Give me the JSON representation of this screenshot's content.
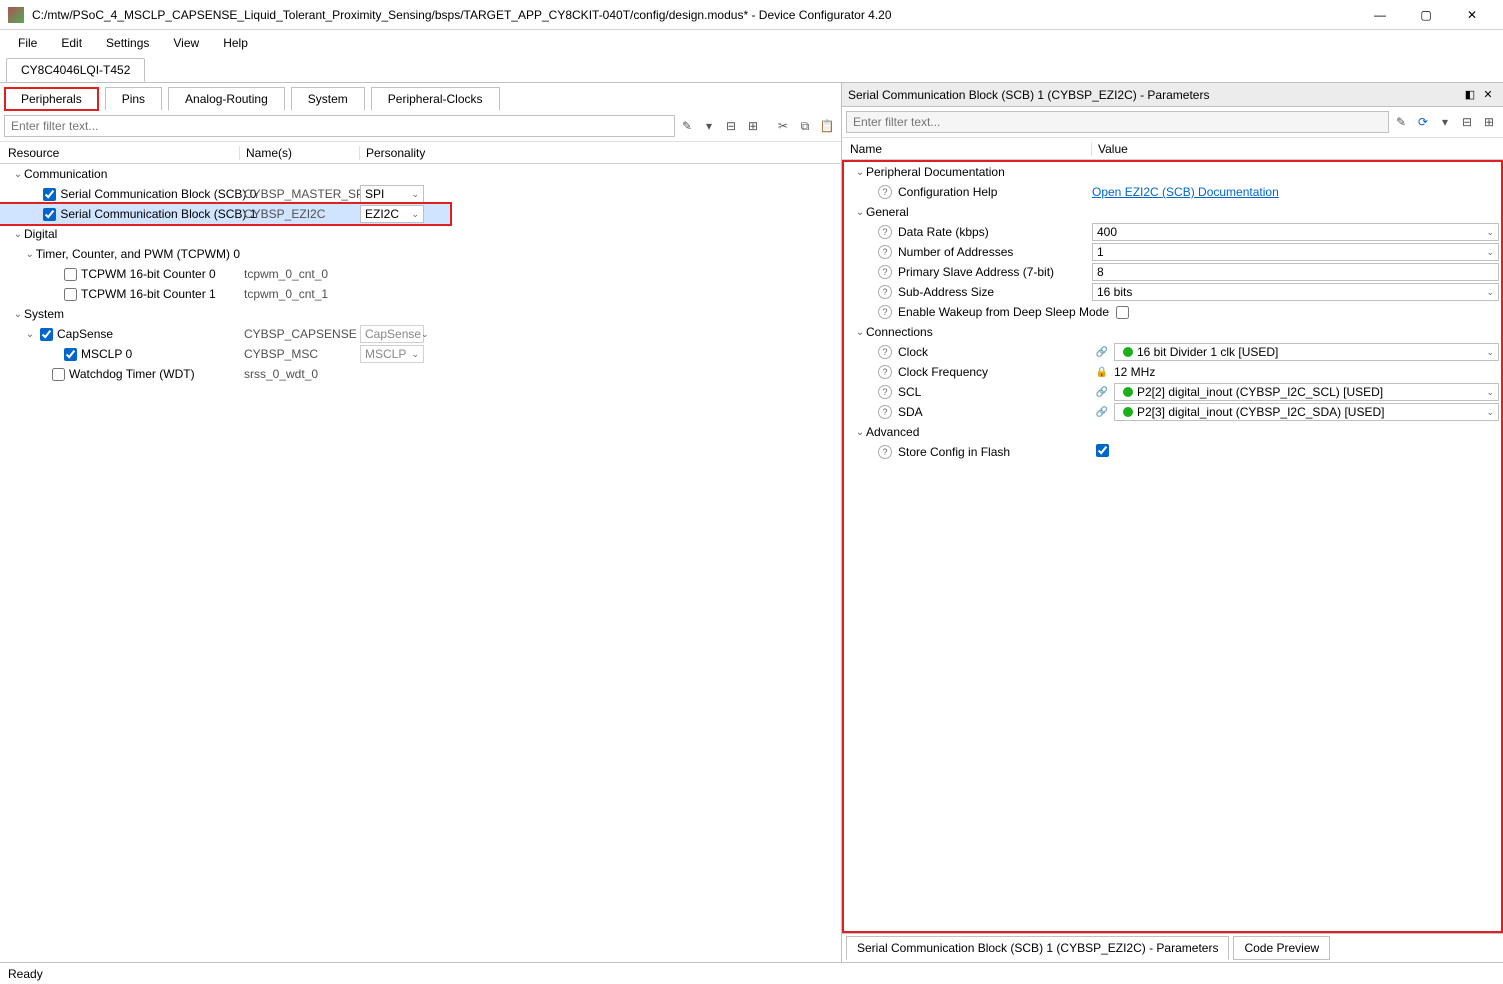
{
  "window": {
    "title": "C:/mtw/PSoC_4_MSCLP_CAPSENSE_Liquid_Tolerant_Proximity_Sensing/bsps/TARGET_APP_CY8CKIT-040T/config/design.modus* - Device Configurator 4.20"
  },
  "menu": {
    "file": "File",
    "edit": "Edit",
    "settings": "Settings",
    "view": "View",
    "help": "Help"
  },
  "chip": {
    "name": "CY8C4046LQI-T452"
  },
  "maintabs": {
    "peripherals": "Peripherals",
    "pins": "Pins",
    "analog": "Analog-Routing",
    "system": "System",
    "pclocks": "Peripheral-Clocks"
  },
  "filter": {
    "placeholder": "Enter filter text..."
  },
  "treecols": {
    "resource": "Resource",
    "names": "Name(s)",
    "personality": "Personality"
  },
  "tree": {
    "communication": "Communication",
    "scb0": {
      "label": "Serial Communication Block (SCB) 0",
      "name": "CYBSP_MASTER_SPI",
      "persona": "SPI"
    },
    "scb1": {
      "label": "Serial Communication Block (SCB) 1",
      "name": "CYBSP_EZI2C",
      "persona": "EZI2C"
    },
    "digital": "Digital",
    "tcpwm": "Timer, Counter, and PWM (TCPWM) 0",
    "tc0": {
      "label": "TCPWM 16-bit Counter 0",
      "name": "tcpwm_0_cnt_0"
    },
    "tc1": {
      "label": "TCPWM 16-bit Counter 1",
      "name": "tcpwm_0_cnt_1"
    },
    "system": "System",
    "capsense": {
      "label": "CapSense",
      "name": "CYBSP_CAPSENSE",
      "persona": "CapSense"
    },
    "msclp": {
      "label": "MSCLP 0",
      "name": "CYBSP_MSC",
      "persona": "MSCLP"
    },
    "wdt": {
      "label": "Watchdog Timer (WDT)",
      "name": "srss_0_wdt_0"
    }
  },
  "right": {
    "title": "Serial Communication Block (SCB) 1 (CYBSP_EZI2C) - Parameters",
    "cols": {
      "name": "Name",
      "value": "Value"
    },
    "groups": {
      "pdoc": "Peripheral Documentation",
      "general": "General",
      "connections": "Connections",
      "advanced": "Advanced"
    },
    "params": {
      "confighelp": {
        "label": "Configuration Help",
        "value": "Open EZI2C (SCB) Documentation"
      },
      "datarate": {
        "label": "Data Rate (kbps)",
        "value": "400"
      },
      "numaddr": {
        "label": "Number of Addresses",
        "value": "1"
      },
      "primaddr": {
        "label": "Primary Slave Address (7-bit)",
        "value": "8"
      },
      "subaddr": {
        "label": "Sub-Address Size",
        "value": "16 bits"
      },
      "wakeup": {
        "label": "Enable Wakeup from Deep Sleep Mode"
      },
      "clock": {
        "label": "Clock",
        "value": "16 bit Divider 1 clk [USED]"
      },
      "clockfreq": {
        "label": "Clock Frequency",
        "value": "12 MHz"
      },
      "scl": {
        "label": "SCL",
        "value": "P2[2] digital_inout (CYBSP_I2C_SCL) [USED]"
      },
      "sda": {
        "label": "SDA",
        "value": "P2[3] digital_inout (CYBSP_I2C_SDA) [USED]"
      },
      "storeflash": {
        "label": "Store Config in Flash"
      }
    },
    "bottomtabs": {
      "params": "Serial Communication Block (SCB) 1 (CYBSP_EZI2C) - Parameters",
      "code": "Code Preview"
    }
  },
  "status": {
    "text": "Ready"
  }
}
